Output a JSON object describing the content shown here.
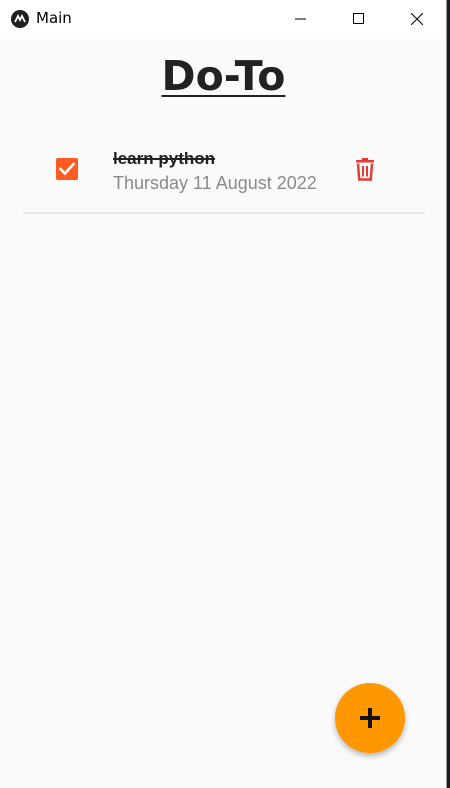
{
  "window": {
    "title": "Main",
    "icon": "kivy-app-icon",
    "controls": {
      "minimize": "minimize-icon",
      "maximize": "maximize-icon",
      "close": "close-icon"
    }
  },
  "app": {
    "title": "Do-To"
  },
  "tasks": [
    {
      "title": "learn python",
      "date": "Thursday 11 August 2022",
      "completed": true,
      "checkbox_icon": "checkmark-icon",
      "delete_icon": "trash-icon"
    }
  ],
  "fab": {
    "icon": "plus-icon"
  },
  "colors": {
    "checkbox": "#ff5a1f",
    "delete": "#e53935",
    "fab": "#ff9800",
    "date_text": "#8a8a8a",
    "background": "#fafafa"
  }
}
